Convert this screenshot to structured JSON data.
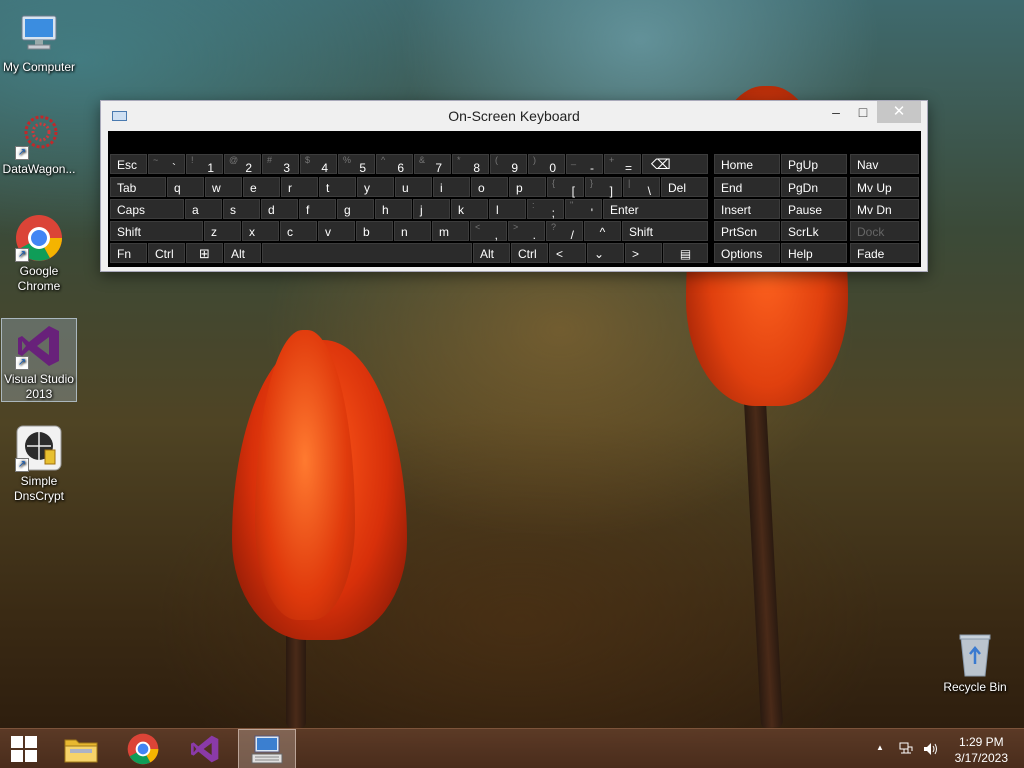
{
  "desktop": {
    "icons": [
      {
        "label": "My Computer"
      },
      {
        "label": "DataWagon..."
      },
      {
        "label": "Google Chrome"
      },
      {
        "label": "Visual Studio 2013"
      },
      {
        "label": "Simple DnsCrypt"
      },
      {
        "label": "Recycle Bin"
      }
    ]
  },
  "osk": {
    "title": "On-Screen Keyboard",
    "controls": {
      "minimize": "–",
      "maximize": "□",
      "close": "✕"
    },
    "row1": [
      {
        "main": "Esc"
      },
      {
        "shift": "~",
        "main": "`"
      },
      {
        "shift": "!",
        "main": "1"
      },
      {
        "shift": "@",
        "main": "2"
      },
      {
        "shift": "#",
        "main": "3"
      },
      {
        "shift": "$",
        "main": "4"
      },
      {
        "shift": "%",
        "main": "5"
      },
      {
        "shift": "^",
        "main": "6"
      },
      {
        "shift": "&",
        "main": "7"
      },
      {
        "shift": "*",
        "main": "8"
      },
      {
        "shift": "(",
        "main": "9"
      },
      {
        "shift": ")",
        "main": "0"
      },
      {
        "shift": "_",
        "main": "-"
      },
      {
        "shift": "+",
        "main": "="
      },
      {
        "main": "⌫"
      }
    ],
    "row2": [
      {
        "main": "Tab"
      },
      {
        "main": "q"
      },
      {
        "main": "w"
      },
      {
        "main": "e"
      },
      {
        "main": "r"
      },
      {
        "main": "t"
      },
      {
        "main": "y"
      },
      {
        "main": "u"
      },
      {
        "main": "i"
      },
      {
        "main": "o"
      },
      {
        "main": "p"
      },
      {
        "shift": "{",
        "main": "["
      },
      {
        "shift": "}",
        "main": "]"
      },
      {
        "shift": "|",
        "main": "\\"
      },
      {
        "main": "Del"
      }
    ],
    "row3": [
      {
        "main": "Caps"
      },
      {
        "main": "a"
      },
      {
        "main": "s"
      },
      {
        "main": "d"
      },
      {
        "main": "f"
      },
      {
        "main": "g"
      },
      {
        "main": "h"
      },
      {
        "main": "j"
      },
      {
        "main": "k"
      },
      {
        "main": "l"
      },
      {
        "shift": ":",
        "main": ";"
      },
      {
        "shift": "\"",
        "main": "'"
      },
      {
        "main": "Enter"
      }
    ],
    "row4": [
      {
        "main": "Shift"
      },
      {
        "main": "z"
      },
      {
        "main": "x"
      },
      {
        "main": "c"
      },
      {
        "main": "v"
      },
      {
        "main": "b"
      },
      {
        "main": "n"
      },
      {
        "main": "m"
      },
      {
        "shift": "<",
        "main": ","
      },
      {
        "shift": ">",
        "main": "."
      },
      {
        "shift": "?",
        "main": "/"
      },
      {
        "main": "^"
      },
      {
        "main": "Shift"
      }
    ],
    "row5": [
      {
        "main": "Fn"
      },
      {
        "main": "Ctrl"
      },
      {
        "main": "⊞"
      },
      {
        "main": "Alt"
      },
      {
        "main": ""
      },
      {
        "main": "Alt"
      },
      {
        "main": "Ctrl"
      },
      {
        "main": "<"
      },
      {
        "main": "⌄"
      },
      {
        "main": ">"
      },
      {
        "main": "▤"
      }
    ],
    "nav": [
      [
        "Home",
        "PgUp",
        "Nav"
      ],
      [
        "End",
        "PgDn",
        "Mv Up"
      ],
      [
        "Insert",
        "Pause",
        "Mv Dn"
      ],
      [
        "PrtScn",
        "ScrLk",
        "Dock"
      ],
      [
        "Options",
        "Help",
        "Fade"
      ]
    ]
  },
  "taskbar": {
    "apps": [
      {
        "name": "start"
      },
      {
        "name": "file-explorer"
      },
      {
        "name": "chrome"
      },
      {
        "name": "visual-studio"
      },
      {
        "name": "on-screen-keyboard"
      }
    ],
    "tray": {
      "chevron": "▲"
    },
    "clock": {
      "time": "1:29 PM",
      "date": "3/17/2023"
    }
  }
}
